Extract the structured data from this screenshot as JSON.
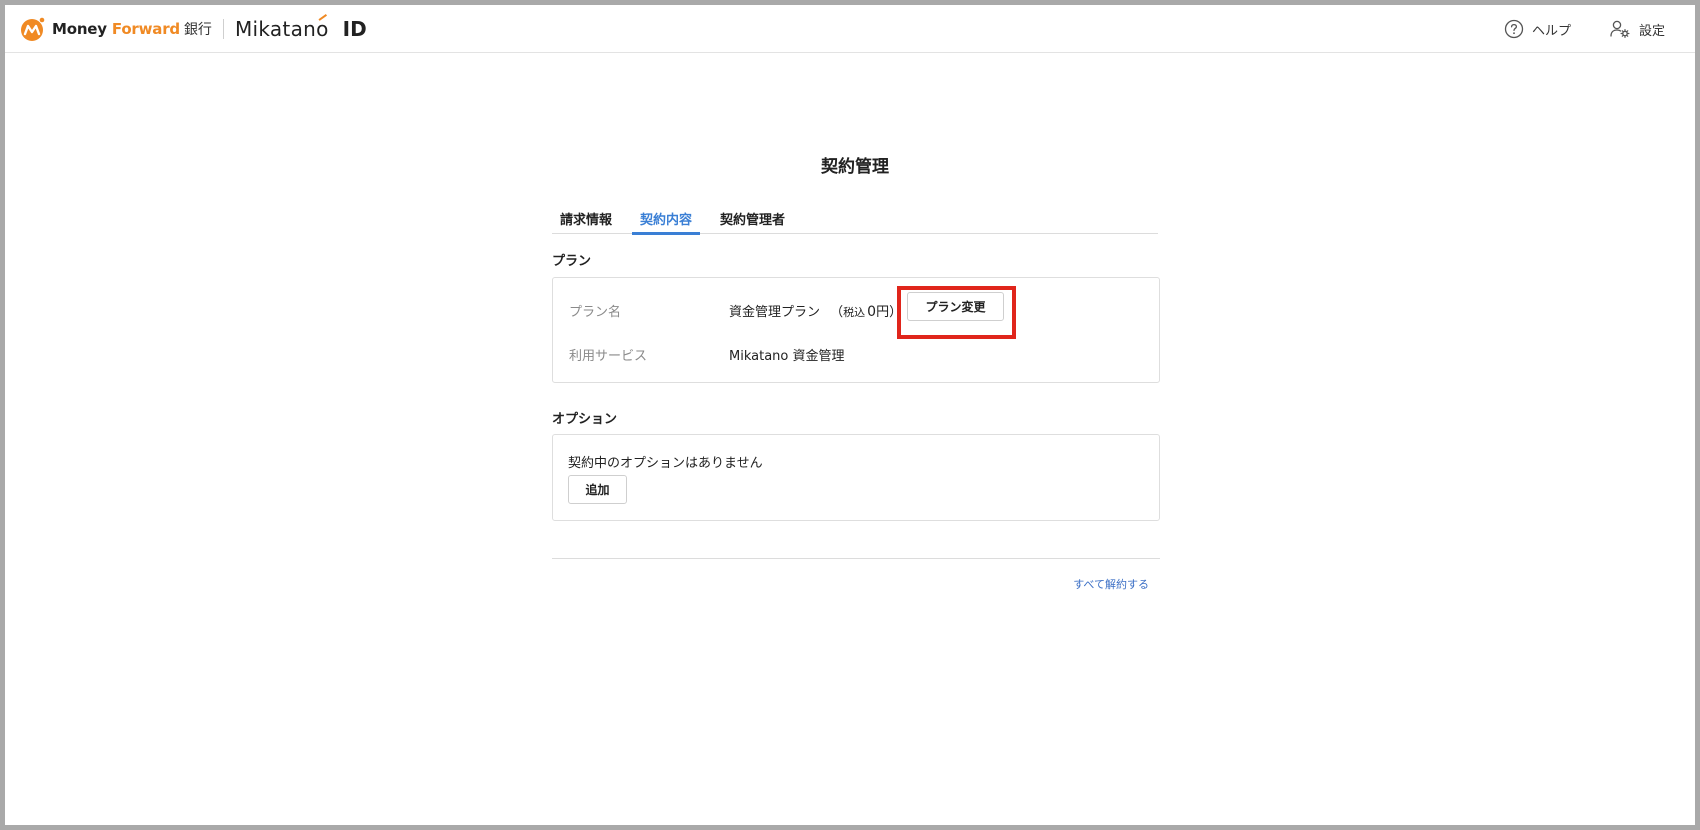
{
  "header": {
    "logo_money": "Money",
    "logo_forward": "Forward",
    "logo_bank": "銀行",
    "product_name": "Mikatano",
    "product_suffix": "ID",
    "help_label": "ヘルプ",
    "settings_label": "設定"
  },
  "page": {
    "title": "契約管理"
  },
  "tabs": [
    {
      "label": "請求情報",
      "active": false
    },
    {
      "label": "契約内容",
      "active": true
    },
    {
      "label": "契約管理者",
      "active": false
    }
  ],
  "plan_section": {
    "heading": "プラン",
    "plan_name_label": "プラン名",
    "plan_name_value": "資金管理プラン",
    "price_open": "（",
    "price_tax": "税込",
    "price_amount": "0",
    "price_unit": "円）",
    "change_button": "プラン変更",
    "service_label": "利用サービス",
    "service_value": "Mikatano 資金管理"
  },
  "option_section": {
    "heading": "オプション",
    "empty_message": "契約中のオプションはありません",
    "add_button": "追加"
  },
  "footer": {
    "cancel_all_link": "すべて解約する"
  },
  "colors": {
    "accent": "#3a7fd5",
    "brand_orange": "#f08a24",
    "highlight": "#e0251b",
    "link": "#3a6ec5"
  }
}
